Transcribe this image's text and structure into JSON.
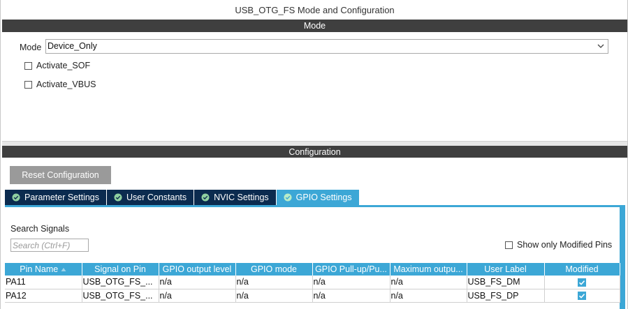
{
  "window": {
    "title": "USB_OTG_FS Mode and Configuration"
  },
  "mode_section": {
    "header": "Mode",
    "mode_label": "Mode",
    "mode_value": "Device_Only",
    "options": [
      {
        "label": "Activate_SOF",
        "checked": false
      },
      {
        "label": "Activate_VBUS",
        "checked": false
      }
    ]
  },
  "config_section": {
    "header": "Configuration",
    "reset_button": "Reset Configuration",
    "tabs": [
      {
        "label": "Parameter Settings",
        "active": false
      },
      {
        "label": "User Constants",
        "active": false
      },
      {
        "label": "NVIC Settings",
        "active": false
      },
      {
        "label": "GPIO Settings",
        "active": true
      }
    ],
    "search": {
      "label": "Search Signals",
      "placeholder": "Search (Ctrl+F)"
    },
    "show_modified": {
      "label": "Show only Modified Pins",
      "checked": false
    },
    "table": {
      "columns": [
        "Pin Name",
        "Signal on Pin",
        "GPIO output level",
        "GPIO mode",
        "GPIO Pull-up/Pu...",
        "Maximum outpu...",
        "User Label",
        "Modified"
      ],
      "rows": [
        {
          "pin": "PA11",
          "signal": "USB_OTG_FS_...",
          "output_level": "n/a",
          "mode": "n/a",
          "pull": "n/a",
          "max_speed": "n/a",
          "user_label": "USB_FS_DM",
          "modified": true
        },
        {
          "pin": "PA12",
          "signal": "USB_OTG_FS_...",
          "output_level": "n/a",
          "mode": "n/a",
          "pull": "n/a",
          "max_speed": "n/a",
          "user_label": "USB_FS_DP",
          "modified": true
        }
      ]
    }
  },
  "colors": {
    "header_bar": "#3f3f3f",
    "tab_inactive": "#0b2b4f",
    "accent": "#3ca7d6",
    "button_gray": "#9a9a9a"
  },
  "icons": {
    "mode_dropdown": "chevron-down-icon",
    "tab_status": "check-circle-icon",
    "sort": "sort-ascending-icon",
    "modified": "checkmark-icon"
  }
}
